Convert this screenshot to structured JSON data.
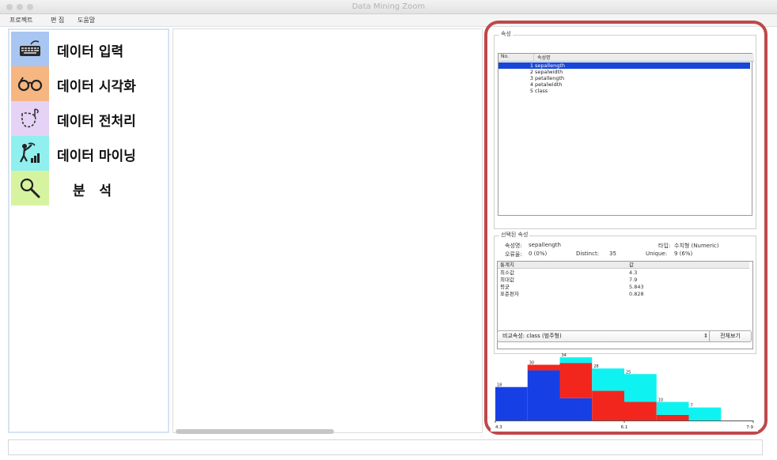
{
  "window": {
    "title": "Data Mining Zoom"
  },
  "menu": [
    "프로젝트",
    "편 집",
    "도움말"
  ],
  "modules": [
    {
      "label": "데이터 입력",
      "icon": "keyboard-icon",
      "color": "#a9c6f2"
    },
    {
      "label": "데이터 시각화",
      "icon": "glasses-icon",
      "color": "#f6b681"
    },
    {
      "label": "데이터 전처리",
      "icon": "dashed-shape-icon",
      "color": "#e6d2f5"
    },
    {
      "label": "데이터 마이닝",
      "icon": "miner-chart-icon",
      "color": "#8ff0ef"
    },
    {
      "label": "분   석",
      "icon": "magnifier-icon",
      "color": "#d6f3a0"
    }
  ],
  "attributes_panel": {
    "title": "속성",
    "columns": [
      "No.",
      "속성명"
    ],
    "rows": [
      {
        "no": "1",
        "name": "sepallength",
        "selected": true
      },
      {
        "no": "2",
        "name": "sepalwidth",
        "selected": false
      },
      {
        "no": "3",
        "name": "petallength",
        "selected": false
      },
      {
        "no": "4",
        "name": "petalwidth",
        "selected": false
      },
      {
        "no": "5",
        "name": "class",
        "selected": false
      }
    ]
  },
  "selected_attribute": {
    "title": "선택된 속성",
    "name_label": "속성명:",
    "name_value": "sepallength",
    "type_label": "타입:",
    "type_value": "수치형 (Numeric)",
    "missing_label": "오류율:",
    "missing_value": "0 (0%)",
    "distinct_label": "Distinct:",
    "distinct_value": "35",
    "unique_label": "Unique:",
    "unique_value": "9 (6%)",
    "stats_columns": [
      "통계치",
      "값"
    ],
    "stats": [
      {
        "k": "최소값",
        "v": "4.3"
      },
      {
        "k": "최대값",
        "v": "7.9"
      },
      {
        "k": "평균",
        "v": "5.843"
      },
      {
        "k": "표준편차",
        "v": "0.828"
      }
    ]
  },
  "compare": {
    "select_value": "비교속성: class (범주형)",
    "button_label": "전체보기"
  },
  "chart_data": {
    "type": "bar",
    "title": "",
    "xlabel": "",
    "ylabel": "",
    "x_ticks": [
      "4.3",
      "6.1",
      "7.9"
    ],
    "xlim": [
      4.3,
      7.9
    ],
    "bin_edges": [
      4.3,
      4.75,
      5.2,
      5.65,
      6.1,
      6.55,
      7.0,
      7.45,
      7.9
    ],
    "totals": [
      "18",
      "30",
      "34",
      "28",
      "25",
      "10",
      "7"
    ],
    "bars": [
      {
        "blue": 18,
        "red": 0,
        "cyan": 0
      },
      {
        "blue": 27,
        "red": 3,
        "cyan": 0
      },
      {
        "blue": 12,
        "red": 19,
        "cyan": 3
      },
      {
        "blue": 0,
        "red": 16,
        "cyan": 12
      },
      {
        "blue": 0,
        "red": 10,
        "cyan": 15
      },
      {
        "blue": 0,
        "red": 3,
        "cyan": 7
      },
      {
        "blue": 0,
        "red": 0,
        "cyan": 7
      }
    ],
    "ylim": [
      0,
      40
    ],
    "colors": {
      "blue": "#1640e6",
      "red": "#f3261e",
      "cyan": "#0ef3f1"
    }
  }
}
